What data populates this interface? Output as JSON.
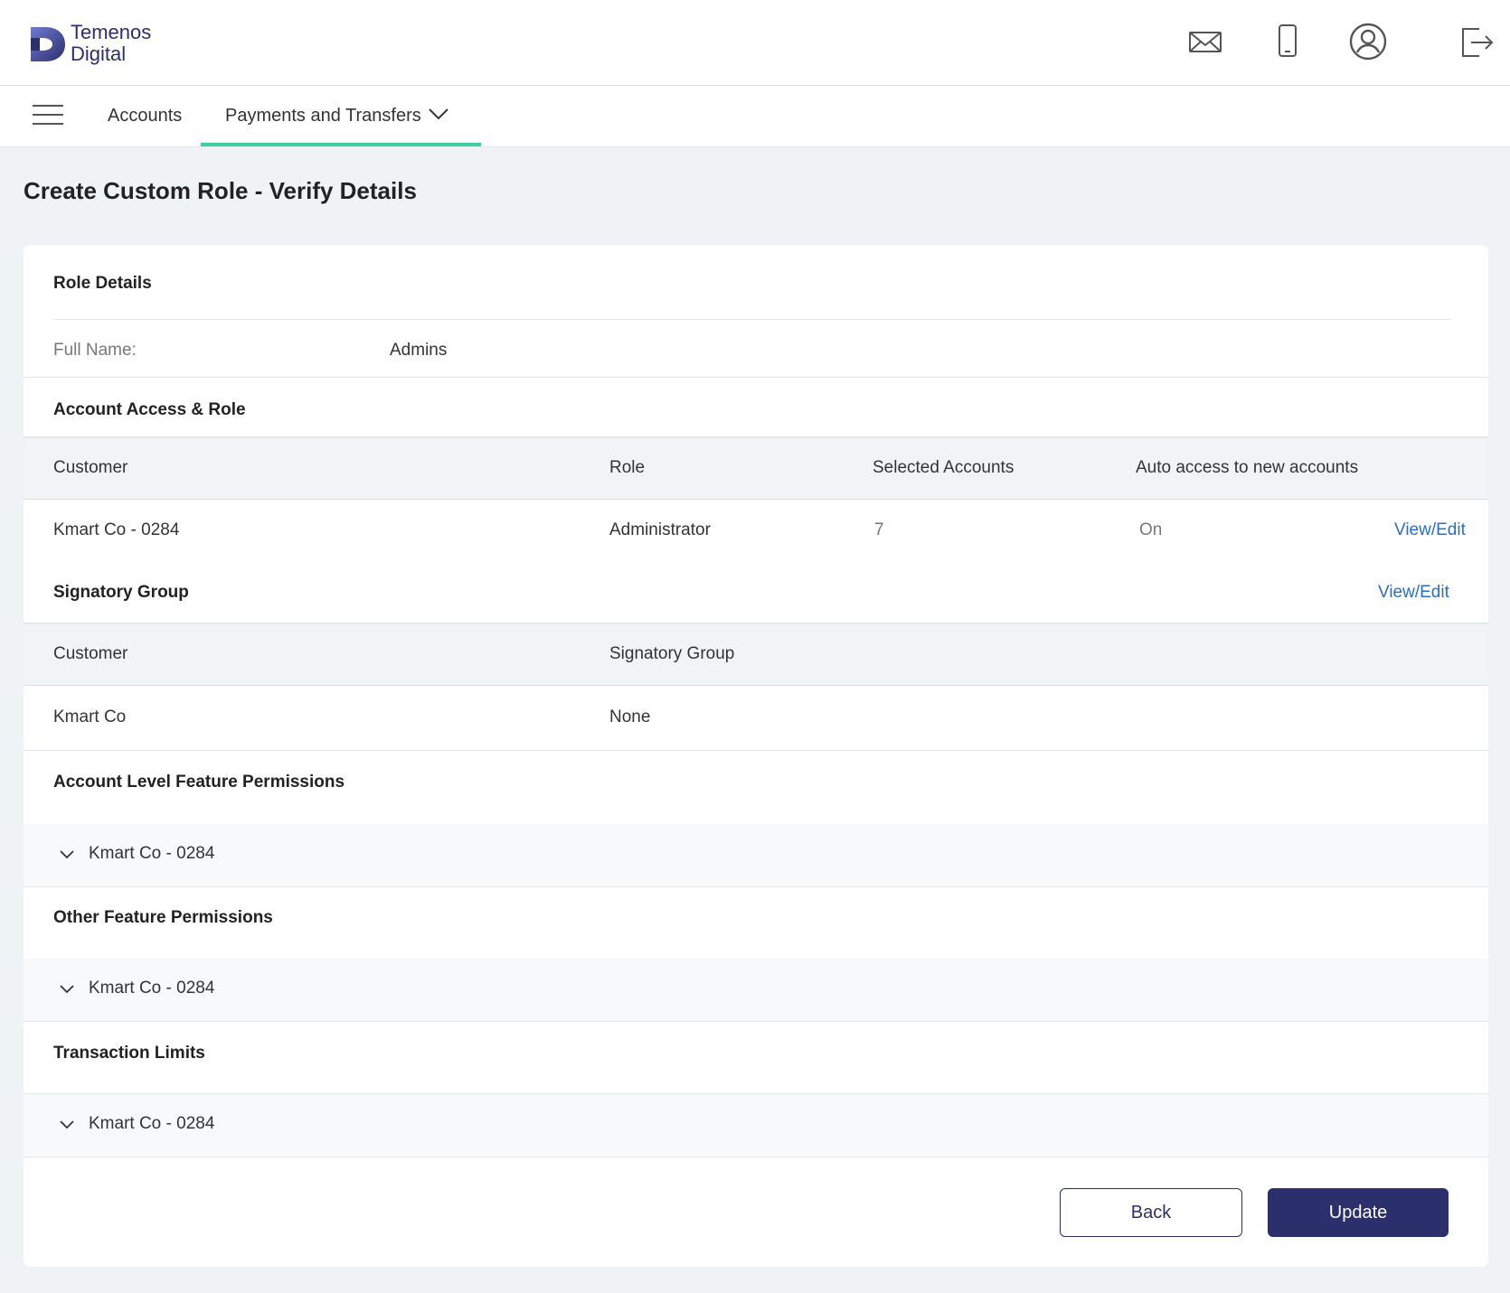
{
  "brand": {
    "line1": "Temenos",
    "line2": "Digital"
  },
  "header_icons": [
    "mail-icon",
    "mobile-icon",
    "profile-icon",
    "logout-icon"
  ],
  "nav": {
    "accounts": "Accounts",
    "payments": "Payments and Transfers"
  },
  "page_title": "Create Custom Role - Verify Details",
  "role_details": {
    "title": "Role Details",
    "full_name_label": "Full Name:",
    "full_name_value": "Admins"
  },
  "account_access": {
    "title": "Account Access & Role",
    "headers": {
      "customer": "Customer",
      "role": "Role",
      "selected_accounts": "Selected Accounts",
      "auto_access": "Auto access to new accounts"
    },
    "row": {
      "customer": "Kmart Co - 0284",
      "role": "Administrator",
      "selected_accounts": "7",
      "auto_access": "On",
      "action": "View/Edit"
    }
  },
  "signatory": {
    "title": "Signatory Group",
    "action": "View/Edit",
    "headers": {
      "customer": "Customer",
      "group": "Signatory Group"
    },
    "row": {
      "customer": "Kmart Co",
      "group": "None"
    }
  },
  "account_level": {
    "title": "Account Level Feature Permissions",
    "item": "Kmart Co - 0284"
  },
  "other_features": {
    "title": "Other Feature Permissions",
    "item": "Kmart Co - 0284"
  },
  "transaction_limits": {
    "title": "Transaction Limits",
    "item": "Kmart Co - 0284"
  },
  "buttons": {
    "back": "Back",
    "update": "Update"
  },
  "colors": {
    "primary": "#2b2f6b",
    "accent": "#3ad1a0",
    "link": "#2a6fc4"
  }
}
